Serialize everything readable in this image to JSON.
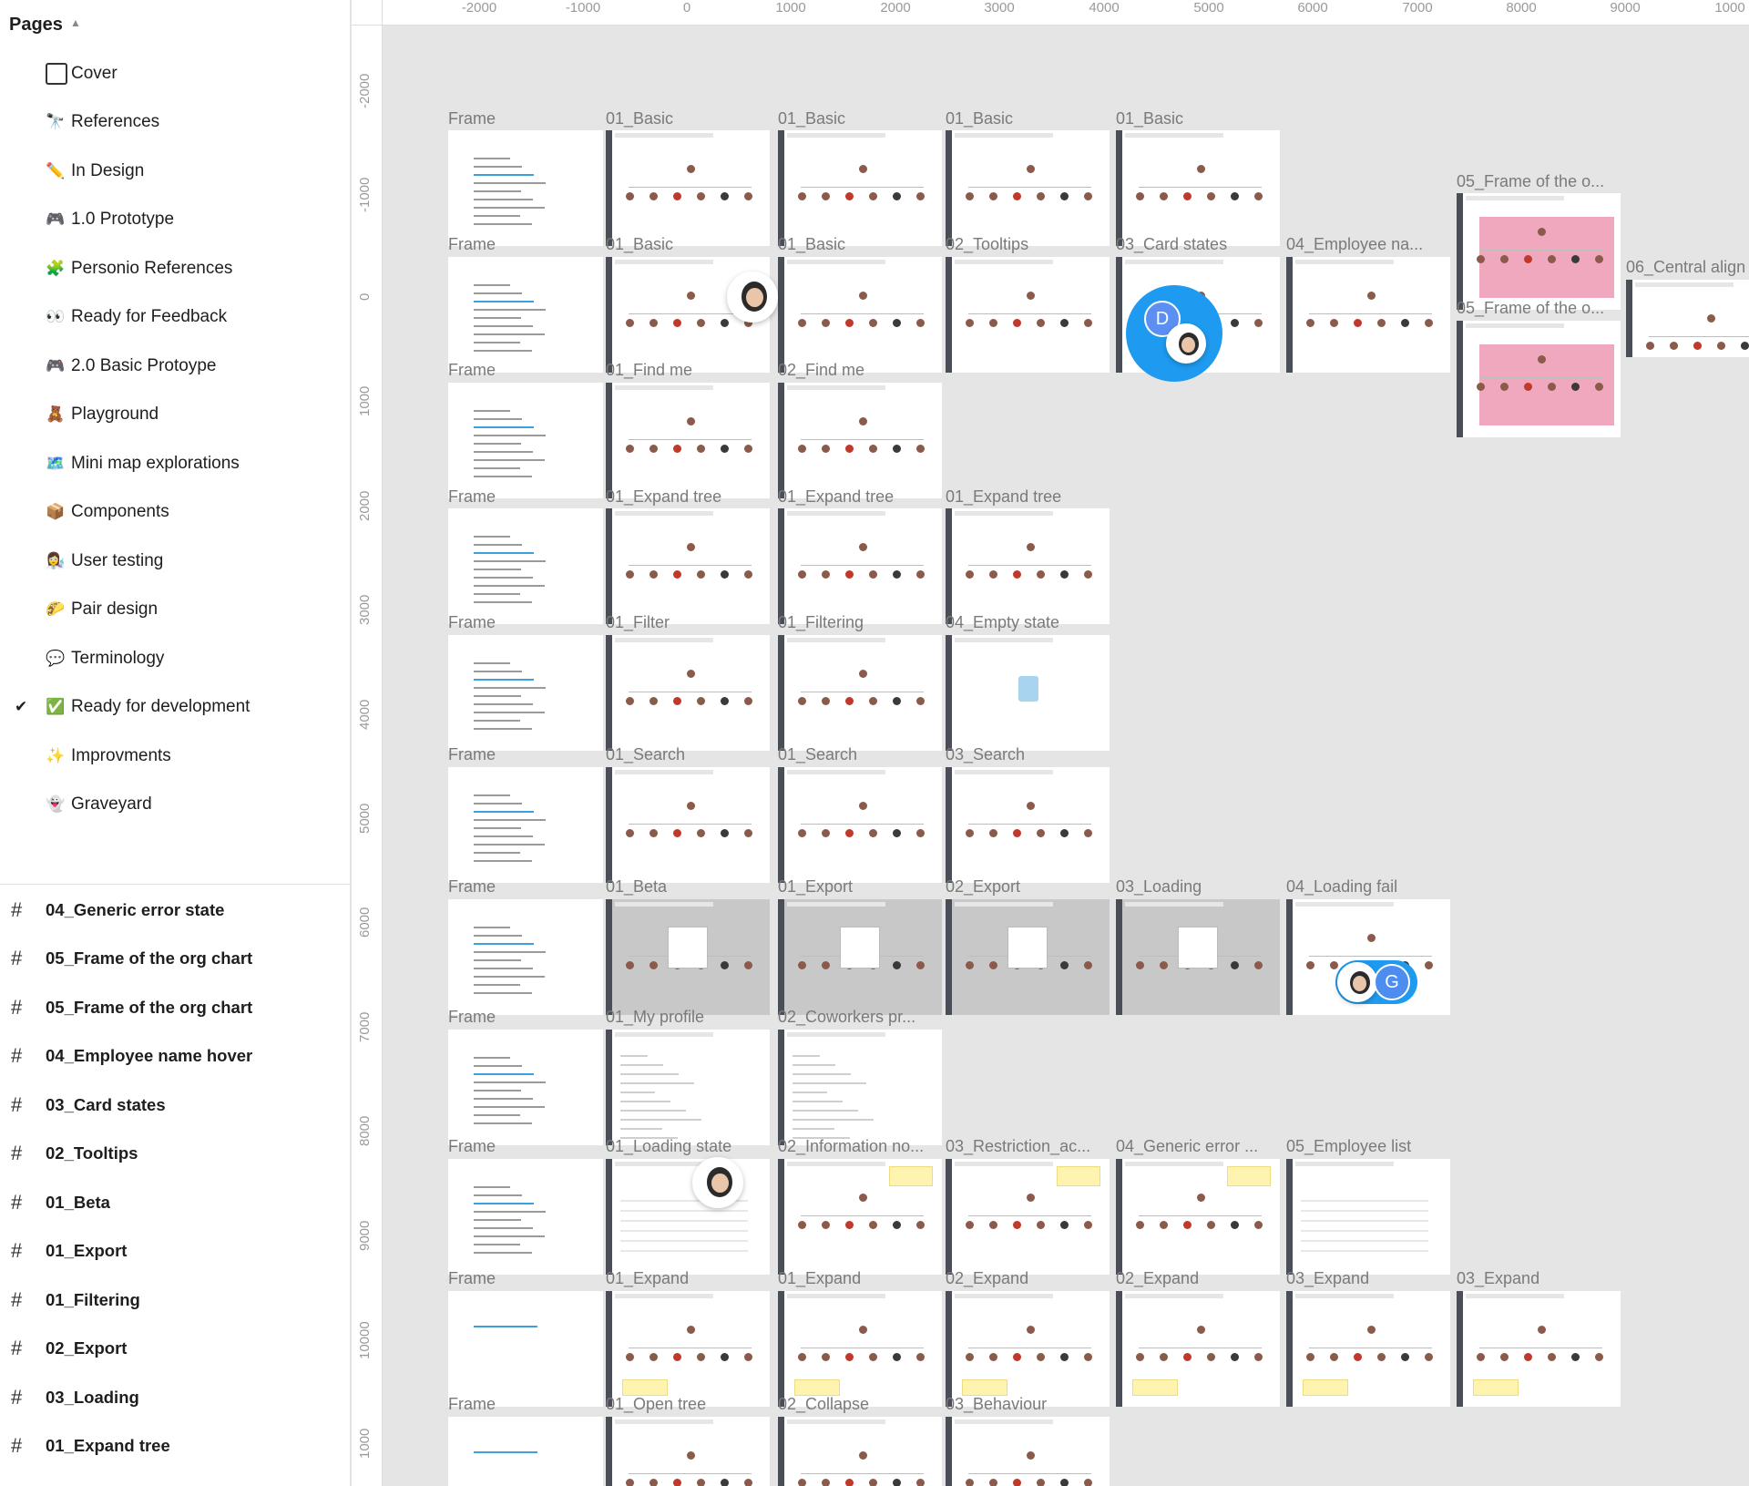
{
  "pages_panel": {
    "header": "Pages",
    "items": [
      {
        "emoji": "",
        "label": "Cover",
        "kind": "cover"
      },
      {
        "emoji": "🔭",
        "label": "References"
      },
      {
        "emoji": "✏️",
        "label": "In Design"
      },
      {
        "emoji": "🎮",
        "label": "1.0 Prototype"
      },
      {
        "emoji": "🧩",
        "label": "Personio References"
      },
      {
        "emoji": "👀",
        "label": "Ready for Feedback"
      },
      {
        "emoji": "🎮",
        "label": "2.0 Basic Protoype"
      },
      {
        "emoji": "🧸",
        "label": "Playground"
      },
      {
        "emoji": "🗺️",
        "label": "Mini map explorations"
      },
      {
        "emoji": "📦",
        "label": "Components"
      },
      {
        "emoji": "👩‍🔬",
        "label": "User testing"
      },
      {
        "emoji": "🌮",
        "label": "Pair design"
      },
      {
        "emoji": "💬",
        "label": "Terminology"
      },
      {
        "emoji": "✅",
        "label": "Ready for development",
        "active": true
      },
      {
        "emoji": "✨",
        "label": "Improvments"
      },
      {
        "emoji": "👻",
        "label": "Graveyard"
      }
    ]
  },
  "layers": [
    "04_Generic error state",
    "05_Frame of the org chart",
    "05_Frame of the org chart",
    "04_Employee name hover",
    "03_Card states",
    "02_Tooltips",
    "01_Beta",
    "01_Export",
    "01_Filtering",
    "02_Export",
    "03_Loading",
    "01_Expand tree"
  ],
  "ruler_x": [
    "-2000",
    "-1000",
    "0",
    "1000",
    "2000",
    "3000",
    "4000",
    "5000",
    "6000",
    "7000",
    "8000",
    "9000",
    "1000"
  ],
  "ruler_y": [
    "-2000",
    "-1000",
    "0",
    "1000",
    "2000",
    "3000",
    "4000",
    "5000",
    "6000",
    "7000",
    "8000",
    "9000",
    "10000",
    "1000"
  ],
  "frame_labels": {
    "r1": [
      "Frame",
      "01_Basic",
      "01_Basic",
      "01_Basic",
      "01_Basic"
    ],
    "r1b": [
      "05_Frame of the o..."
    ],
    "r2": [
      "Frame",
      "01_Basic",
      "01_Basic",
      "02_Tooltips",
      "03_Card states",
      "04_Employee na..."
    ],
    "r2b": [
      "06_Central align",
      "05_Frame of the o..."
    ],
    "r3": [
      "Frame",
      "01_Find me",
      "02_Find me"
    ],
    "r4": [
      "Frame",
      "01_Expand tree",
      "01_Expand tree",
      "01_Expand tree"
    ],
    "r5": [
      "Frame",
      "01_Filter",
      "01_Filtering",
      "04_Empty state"
    ],
    "r6": [
      "Frame",
      "01_Search",
      "01_Search",
      "03_Search"
    ],
    "r7": [
      "Frame",
      "01_Beta",
      "01_Export",
      "02_Export",
      "03_Loading",
      "04_Loading fail"
    ],
    "r8": [
      "Frame",
      "01_My profile",
      "02_Coworkers pr..."
    ],
    "r9": [
      "Frame",
      "01_Loading state",
      "02_Information no...",
      "03_Restriction_ac...",
      "04_Generic error ...",
      "05_Employee list"
    ],
    "r10": [
      "Frame",
      "01_Expand",
      "01_Expand",
      "02_Expand",
      "02_Expand",
      "03_Expand",
      "03_Expand"
    ],
    "r11": [
      "Frame",
      "01_Open tree",
      "02_Collapse",
      "03_Behaviour"
    ]
  },
  "cursors": {
    "d_letter": "D",
    "g_letter": "G"
  },
  "colors": {
    "accent": "#1e9bf0",
    "pink": "#f0a8bf",
    "canvas": "#e5e5e5"
  }
}
